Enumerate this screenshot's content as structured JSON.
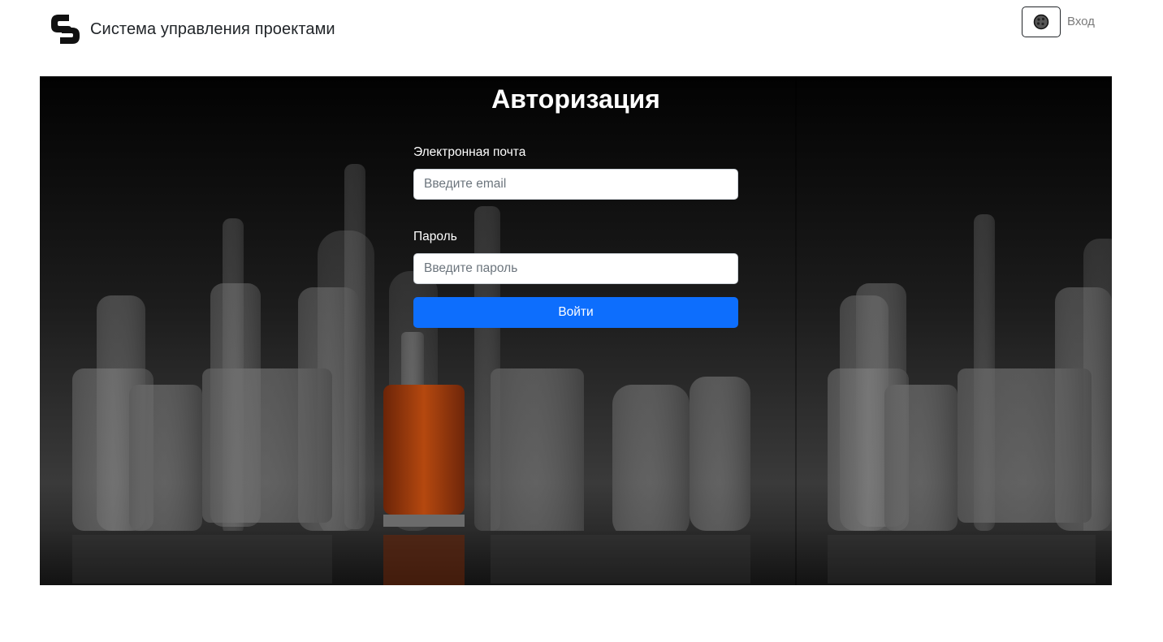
{
  "header": {
    "brand_title": "Система управления проектами",
    "theme_toggle_icon": "palette-icon",
    "login_link": "Вход"
  },
  "auth": {
    "title": "Авторизация",
    "email_label": "Электронная почта",
    "email_placeholder": "Введите email",
    "email_value": "",
    "password_label": "Пароль",
    "password_placeholder": "Введите пароль",
    "password_value": "",
    "submit_label": "Войти"
  },
  "colors": {
    "primary_button": "#0d6efd",
    "hero_background": "#0b0b0b",
    "header_text": "#212529",
    "muted_link": "#7a7a7a"
  }
}
